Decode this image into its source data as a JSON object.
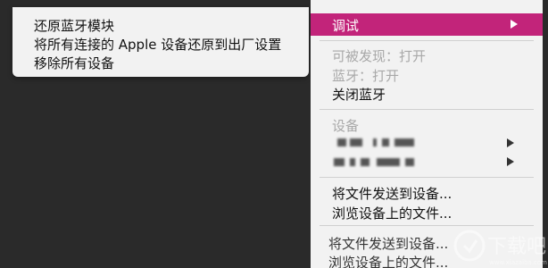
{
  "submenu": {
    "items": [
      {
        "label": "还原蓝牙模块"
      },
      {
        "label": "将所有连接的 Apple 设备还原到出厂设置"
      },
      {
        "label": "移除所有设备"
      }
    ]
  },
  "menu": {
    "debug_label": "调试",
    "discoverable_label": "可被发现：打开",
    "bluetooth_status_label": "蓝牙：打开",
    "turn_off_label": "关闭蓝牙",
    "devices_header": "设备",
    "send_file_label": "将文件发送到设备...",
    "browse_files_label": "浏览设备上的文件...",
    "send_file_label_dup": "将文件发送到设备...",
    "browse_files_label_dup": "浏览设备上的文件..."
  },
  "watermark": {
    "text": "下载吧",
    "site": "www.xiazaiba.com"
  },
  "colors": {
    "highlight": "#c2247a",
    "menu_bg": "#f2f2f2",
    "desktop_bg": "#2a2a2a"
  }
}
